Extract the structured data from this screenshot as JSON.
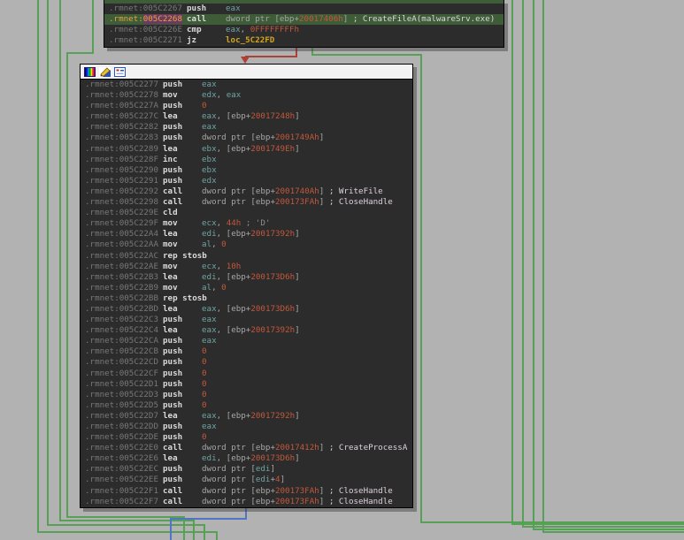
{
  "app": {
    "view": "ida-graph-view",
    "segment": ".rmnet"
  },
  "colors": {
    "bg": "#b2b2b2",
    "node-bg": "#2c2c2c",
    "node-border": "#000000",
    "titlebar": "#f2f2f2",
    "hl-row": "#3d5c37",
    "adr": "#787878",
    "adr-hl-text": "#e6a43e",
    "adr-hl-bg": "#6a3a60",
    "mn": "#dadada",
    "txt": "#a6a6a6",
    "reg": "#6fa3a3",
    "num": "#c2583b",
    "loc": "#d4a51c",
    "api": "#ded3de",
    "gcmt": "#8c8c8c",
    "edge-green": "#56a156",
    "edge-red": "#ac4137",
    "edge-blue": "#4f74c8"
  },
  "blocks": [
    {
      "name": "basic-block-005C2267",
      "rows": [
        {
          "partial": true
        },
        {
          "a": ".rmnet:005C2267",
          "m": "push",
          "o": [
            [
              "reg",
              "eax"
            ]
          ]
        },
        {
          "a": ".rmnet:005C2268",
          "ahl": true,
          "hl": true,
          "m": "call",
          "o": [
            [
              "txt",
              "dword ptr [ebp+"
            ],
            [
              "num",
              "20017406h"
            ],
            [
              "txt",
              "]"
            ],
            [
              "api",
              " ; CreateFileA(malwareSrv.exe)"
            ]
          ]
        },
        {
          "a": ".rmnet:005C226E",
          "m": "cmp",
          "o": [
            [
              "reg",
              "eax"
            ],
            [
              "txt",
              ", "
            ],
            [
              "num",
              "0FFFFFFFFh"
            ]
          ]
        },
        {
          "a": ".rmnet:005C2271",
          "m": "jz",
          "o": [
            [
              "loc",
              "loc_5C22FD"
            ]
          ]
        }
      ]
    },
    {
      "name": "basic-block-005C2277",
      "titlebar_icons": [
        "node-color-palette-icon",
        "node-edit-color-icon",
        "node-frame-icon"
      ],
      "rows": [
        {
          "a": ".rmnet:005C2277",
          "m": "push",
          "o": [
            [
              "reg",
              "eax"
            ]
          ]
        },
        {
          "a": ".rmnet:005C2278",
          "m": "mov",
          "o": [
            [
              "reg",
              "edx"
            ],
            [
              "txt",
              ", "
            ],
            [
              "reg",
              "eax"
            ]
          ]
        },
        {
          "a": ".rmnet:005C227A",
          "m": "push",
          "o": [
            [
              "num",
              "0"
            ]
          ]
        },
        {
          "a": ".rmnet:005C227C",
          "m": "lea",
          "o": [
            [
              "reg",
              "eax"
            ],
            [
              "txt",
              ", [ebp+"
            ],
            [
              "num",
              "20017248h"
            ],
            [
              "txt",
              "]"
            ]
          ]
        },
        {
          "a": ".rmnet:005C2282",
          "m": "push",
          "o": [
            [
              "reg",
              "eax"
            ]
          ]
        },
        {
          "a": ".rmnet:005C2283",
          "m": "push",
          "o": [
            [
              "txt",
              "dword ptr [ebp+"
            ],
            [
              "num",
              "2001749Ah"
            ],
            [
              "txt",
              "]"
            ]
          ]
        },
        {
          "a": ".rmnet:005C2289",
          "m": "lea",
          "o": [
            [
              "reg",
              "ebx"
            ],
            [
              "txt",
              ", [ebp+"
            ],
            [
              "num",
              "2001749Eh"
            ],
            [
              "txt",
              "]"
            ]
          ]
        },
        {
          "a": ".rmnet:005C228F",
          "m": "inc",
          "o": [
            [
              "reg",
              "ebx"
            ]
          ]
        },
        {
          "a": ".rmnet:005C2290",
          "m": "push",
          "o": [
            [
              "reg",
              "ebx"
            ]
          ]
        },
        {
          "a": ".rmnet:005C2291",
          "m": "push",
          "o": [
            [
              "reg",
              "edx"
            ]
          ]
        },
        {
          "a": ".rmnet:005C2292",
          "m": "call",
          "o": [
            [
              "txt",
              "dword ptr [ebp+"
            ],
            [
              "num",
              "2001740Ah"
            ],
            [
              "txt",
              "]"
            ],
            [
              "api",
              " ; WriteFile"
            ]
          ]
        },
        {
          "a": ".rmnet:005C2298",
          "m": "call",
          "o": [
            [
              "txt",
              "dword ptr [ebp+"
            ],
            [
              "num",
              "200173FAh"
            ],
            [
              "txt",
              "]"
            ],
            [
              "api",
              " ; CloseHandle"
            ]
          ]
        },
        {
          "a": ".rmnet:005C229E",
          "m": "cld",
          "o": []
        },
        {
          "a": ".rmnet:005C229F",
          "m": "mov",
          "o": [
            [
              "reg",
              "ecx"
            ],
            [
              "txt",
              ", "
            ],
            [
              "num",
              "44h"
            ],
            [
              "gcmt",
              " ; 'D'"
            ]
          ]
        },
        {
          "a": ".rmnet:005C22A4",
          "m": "lea",
          "o": [
            [
              "reg",
              "edi"
            ],
            [
              "txt",
              ", [ebp+"
            ],
            [
              "num",
              "20017392h"
            ],
            [
              "txt",
              "]"
            ]
          ]
        },
        {
          "a": ".rmnet:005C22AA",
          "m": "mov",
          "o": [
            [
              "reg",
              "al"
            ],
            [
              "txt",
              ", "
            ],
            [
              "num",
              "0"
            ]
          ]
        },
        {
          "a": ".rmnet:005C22AC",
          "m": "rep stosb",
          "o": []
        },
        {
          "a": ".rmnet:005C22AE",
          "m": "mov",
          "o": [
            [
              "reg",
              "ecx"
            ],
            [
              "txt",
              ", "
            ],
            [
              "num",
              "10h"
            ]
          ]
        },
        {
          "a": ".rmnet:005C22B3",
          "m": "lea",
          "o": [
            [
              "reg",
              "edi"
            ],
            [
              "txt",
              ", [ebp+"
            ],
            [
              "num",
              "200173D6h"
            ],
            [
              "txt",
              "]"
            ]
          ]
        },
        {
          "a": ".rmnet:005C22B9",
          "m": "mov",
          "o": [
            [
              "reg",
              "al"
            ],
            [
              "txt",
              ", "
            ],
            [
              "num",
              "0"
            ]
          ]
        },
        {
          "a": ".rmnet:005C22BB",
          "m": "rep stosb",
          "o": []
        },
        {
          "a": ".rmnet:005C22BD",
          "m": "lea",
          "o": [
            [
              "reg",
              "eax"
            ],
            [
              "txt",
              ", [ebp+"
            ],
            [
              "num",
              "200173D6h"
            ],
            [
              "txt",
              "]"
            ]
          ]
        },
        {
          "a": ".rmnet:005C22C3",
          "m": "push",
          "o": [
            [
              "reg",
              "eax"
            ]
          ]
        },
        {
          "a": ".rmnet:005C22C4",
          "m": "lea",
          "o": [
            [
              "reg",
              "eax"
            ],
            [
              "txt",
              ", [ebp+"
            ],
            [
              "num",
              "20017392h"
            ],
            [
              "txt",
              "]"
            ]
          ]
        },
        {
          "a": ".rmnet:005C22CA",
          "m": "push",
          "o": [
            [
              "reg",
              "eax"
            ]
          ]
        },
        {
          "a": ".rmnet:005C22CB",
          "m": "push",
          "o": [
            [
              "num",
              "0"
            ]
          ]
        },
        {
          "a": ".rmnet:005C22CD",
          "m": "push",
          "o": [
            [
              "num",
              "0"
            ]
          ]
        },
        {
          "a": ".rmnet:005C22CF",
          "m": "push",
          "o": [
            [
              "num",
              "0"
            ]
          ]
        },
        {
          "a": ".rmnet:005C22D1",
          "m": "push",
          "o": [
            [
              "num",
              "0"
            ]
          ]
        },
        {
          "a": ".rmnet:005C22D3",
          "m": "push",
          "o": [
            [
              "num",
              "0"
            ]
          ]
        },
        {
          "a": ".rmnet:005C22D5",
          "m": "push",
          "o": [
            [
              "num",
              "0"
            ]
          ]
        },
        {
          "a": ".rmnet:005C22D7",
          "m": "lea",
          "o": [
            [
              "reg",
              "eax"
            ],
            [
              "txt",
              ", [ebp+"
            ],
            [
              "num",
              "20017292h"
            ],
            [
              "txt",
              "]"
            ]
          ]
        },
        {
          "a": ".rmnet:005C22DD",
          "m": "push",
          "o": [
            [
              "reg",
              "eax"
            ]
          ]
        },
        {
          "a": ".rmnet:005C22DE",
          "m": "push",
          "o": [
            [
              "num",
              "0"
            ]
          ]
        },
        {
          "a": ".rmnet:005C22E0",
          "m": "call",
          "o": [
            [
              "txt",
              "dword ptr [ebp+"
            ],
            [
              "num",
              "20017412h"
            ],
            [
              "txt",
              "]"
            ],
            [
              "api",
              " ; CreateProcessA"
            ]
          ]
        },
        {
          "a": ".rmnet:005C22E6",
          "m": "lea",
          "o": [
            [
              "reg",
              "edi"
            ],
            [
              "txt",
              ", [ebp+"
            ],
            [
              "num",
              "200173D6h"
            ],
            [
              "txt",
              "]"
            ]
          ]
        },
        {
          "a": ".rmnet:005C22EC",
          "m": "push",
          "o": [
            [
              "txt",
              "dword ptr ["
            ],
            [
              "reg",
              "edi"
            ],
            [
              "txt",
              "]"
            ]
          ]
        },
        {
          "a": ".rmnet:005C22EE",
          "m": "push",
          "o": [
            [
              "txt",
              "dword ptr ["
            ],
            [
              "reg",
              "edi"
            ],
            [
              "txt",
              "+"
            ],
            [
              "num",
              "4"
            ],
            [
              "txt",
              "]"
            ]
          ]
        },
        {
          "a": ".rmnet:005C22F1",
          "m": "call",
          "o": [
            [
              "txt",
              "dword ptr [ebp+"
            ],
            [
              "num",
              "200173FAh"
            ],
            [
              "txt",
              "]"
            ],
            [
              "api",
              " ; CloseHandle"
            ]
          ]
        },
        {
          "a": ".rmnet:005C22F7",
          "m": "call",
          "o": [
            [
              "txt",
              "dword ptr [ebp+"
            ],
            [
              "num",
              "200173FAh"
            ],
            [
              "txt",
              "]"
            ],
            [
              "api",
              " ; CloseHandle"
            ]
          ]
        }
      ]
    }
  ]
}
